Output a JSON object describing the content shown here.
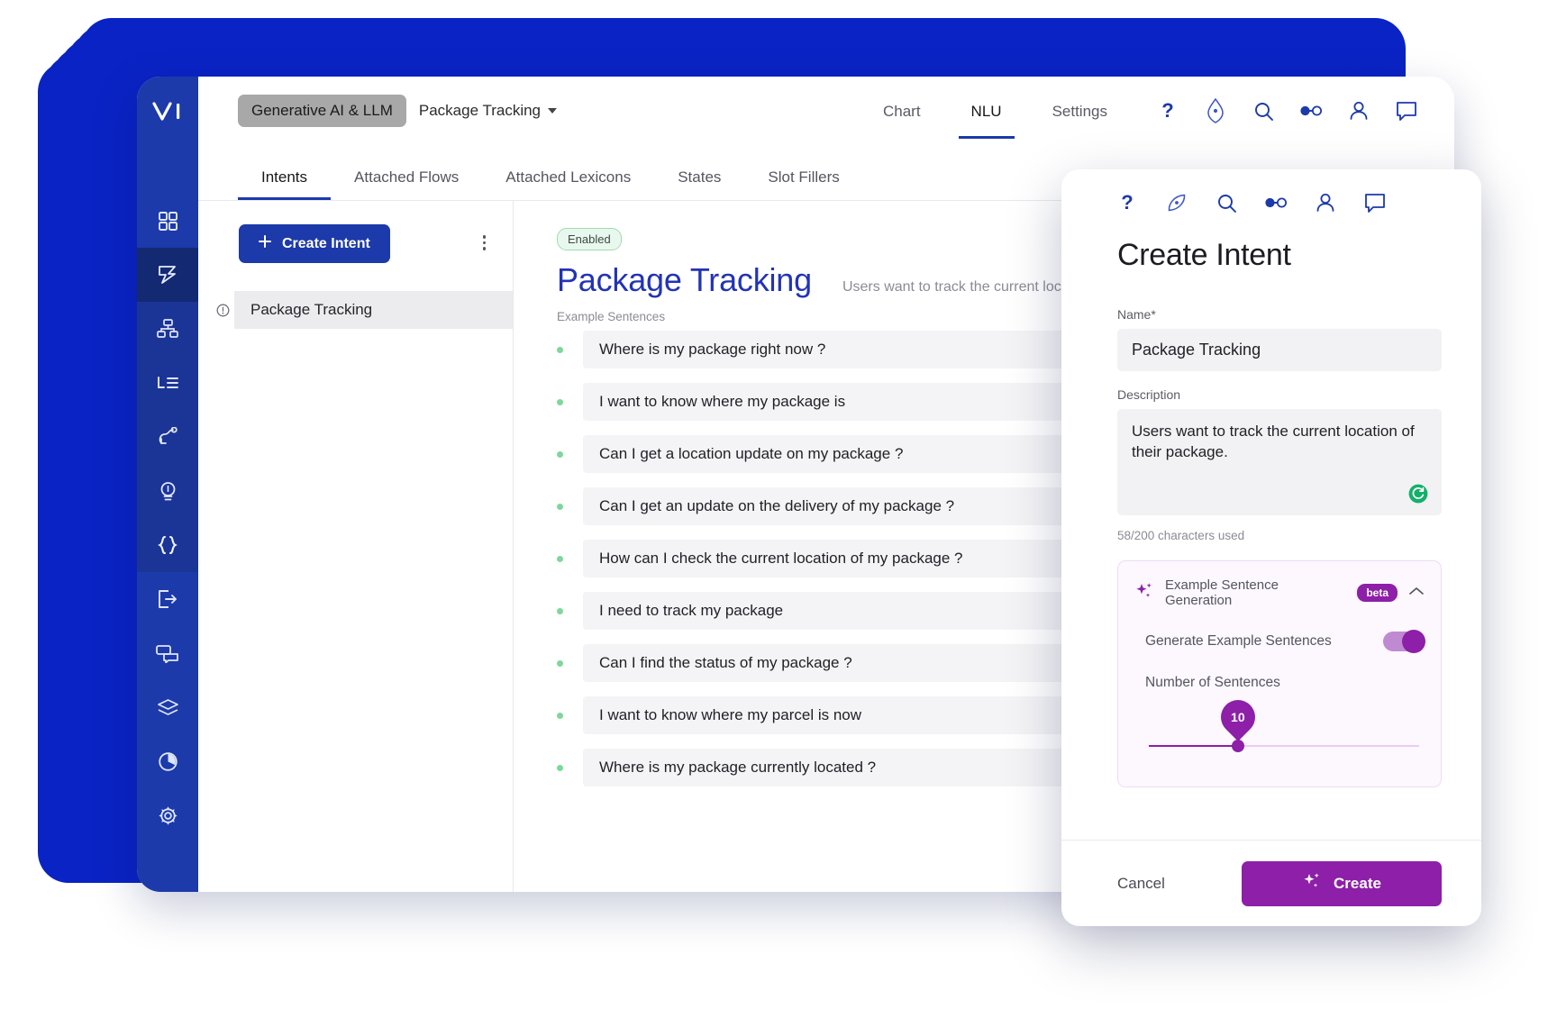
{
  "app": {
    "logo": "ai-logo",
    "project_chip": "Generative AI & LLM",
    "project_name": "Package Tracking"
  },
  "rail": {
    "items": [
      {
        "name": "dashboard-icon",
        "label": "Dashboard",
        "active": false
      },
      {
        "name": "intents-icon",
        "label": "Intents",
        "active": true
      },
      {
        "name": "flows-icon",
        "label": "Flows",
        "active": false
      },
      {
        "name": "lexicons-icon",
        "label": "Lexicons",
        "active": false
      },
      {
        "name": "plug-icon",
        "label": "Integrations",
        "active": false
      },
      {
        "name": "bulb-icon",
        "label": "Insights",
        "active": false
      },
      {
        "name": "code-braces-icon",
        "label": "Code",
        "active": false
      },
      {
        "name": "deploy-icon",
        "label": "Deploy",
        "active": false
      },
      {
        "name": "chat-icon",
        "label": "Conversations",
        "active": false
      },
      {
        "name": "layers-icon",
        "label": "Layers",
        "active": false
      },
      {
        "name": "analytics-icon",
        "label": "Analytics",
        "active": false
      },
      {
        "name": "settings-gear-icon",
        "label": "Settings",
        "active": false
      }
    ]
  },
  "header": {
    "tabs": [
      {
        "label": "Chart",
        "active": false
      },
      {
        "label": "NLU",
        "active": true
      },
      {
        "label": "Settings",
        "active": false
      }
    ],
    "icons": [
      "help-question-icon",
      "compass-icon",
      "search-icon",
      "link-nodes-icon",
      "user-account-icon",
      "message-icon"
    ]
  },
  "subtabs": [
    {
      "label": "Intents",
      "active": true
    },
    {
      "label": "Attached Flows",
      "active": false
    },
    {
      "label": "Attached Lexicons",
      "active": false
    },
    {
      "label": "States",
      "active": false
    },
    {
      "label": "Slot Fillers",
      "active": false
    }
  ],
  "intent_panel": {
    "create_button": "Create Intent",
    "create_button_icon": "plus-icon",
    "kebab_icon": "more-vertical-icon",
    "items": [
      {
        "label": "Package Tracking",
        "icon": "info-circle-icon",
        "selected": true
      }
    ]
  },
  "detail": {
    "status_badge": "Enabled",
    "title": "Package Tracking",
    "description": "Users want to track the current location of their package.",
    "example_label": "Example Sentences",
    "examples": [
      "Where is my package right now ?",
      "I want to know where my package is",
      "Can I get a location update on my package ?",
      "Can I get an update on the delivery of my package ?",
      "How can I check the current location of my package ?",
      "I need to track my package",
      "Can I find the status of my package ?",
      "I want to know where my parcel is now",
      "Where is my package currently located ?"
    ]
  },
  "modal": {
    "icons": [
      "help-question-icon",
      "compass-icon",
      "search-icon",
      "link-nodes-icon",
      "user-account-icon",
      "message-icon"
    ],
    "title": "Create Intent",
    "name_label": "Name",
    "name_required_mark": "*",
    "name_value": "Package Tracking",
    "description_label": "Description",
    "description_value": "Users want to track the current location of their package.",
    "regenerate_icon": "refresh-icon",
    "char_count": "58/200 characters used",
    "esg": {
      "sparkle_icon": "sparkle-icon",
      "title": "Example Sentence Generation",
      "badge": "beta",
      "chevron_icon": "chevron-up-icon",
      "generate_label": "Generate Example Sentences",
      "generate_enabled": true,
      "number_label": "Number of Sentences",
      "number_value": "10",
      "slider_min": 1,
      "slider_max": 30
    },
    "cancel_label": "Cancel",
    "create_label": "Create",
    "create_icon": "sparkle-icon"
  },
  "colors": {
    "rail_blue": "#1c3aa9",
    "accent_blue": "#2233b5",
    "accent_purple": "#8d1fa8",
    "badge_green": "#9fdbaf",
    "shadow_blue": "#0a23c4"
  }
}
